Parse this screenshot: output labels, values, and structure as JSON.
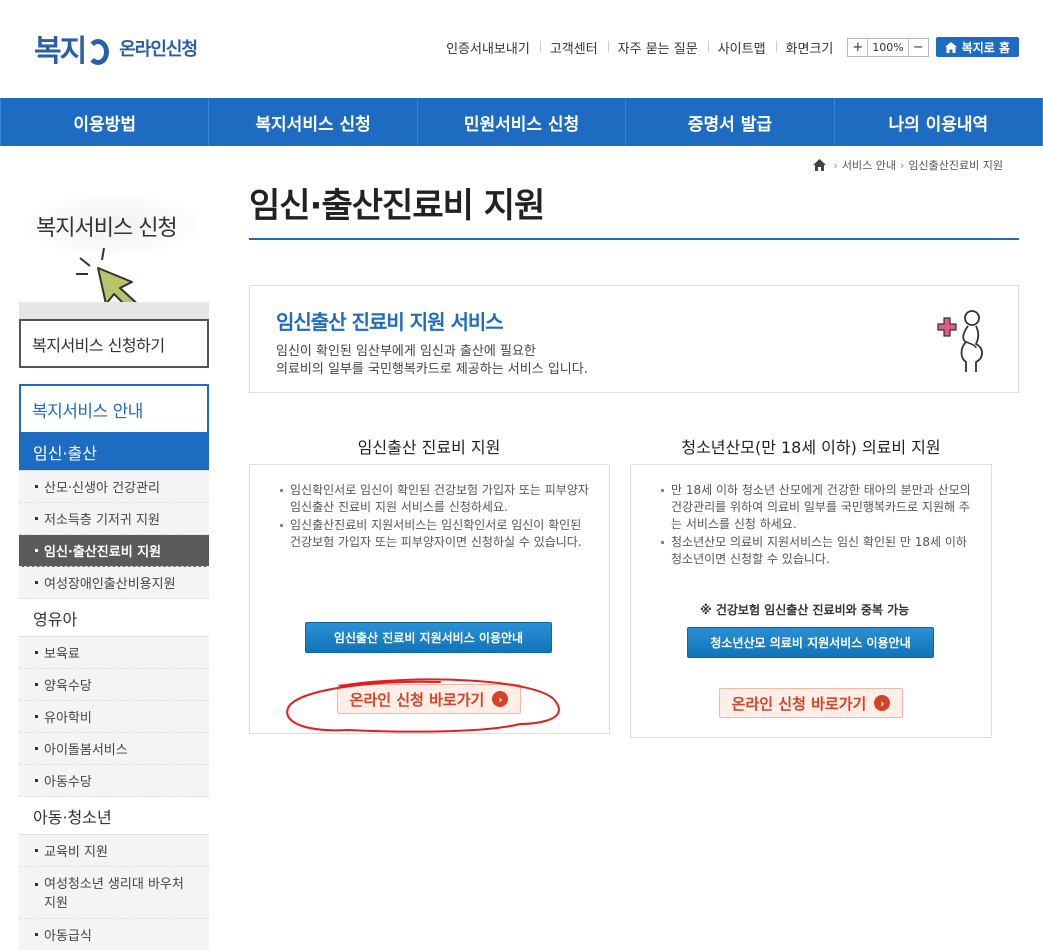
{
  "header": {
    "logo_text": "복지",
    "logo_sub": "온라인신청",
    "util_links": [
      "인증서내보내기",
      "고객센터",
      "자주 묻는 질문",
      "사이트맵"
    ],
    "zoom_label": "화면크기",
    "zoom_plus": "+",
    "zoom_value": "100%",
    "zoom_minus": "−",
    "home_button": "복지로 홈"
  },
  "gnb": [
    "이용방법",
    "복지서비스 신청",
    "민원서비스 신청",
    "증명서 발급",
    "나의 이용내역"
  ],
  "sidebar": {
    "title": "복지서비스 신청",
    "apply_link": "복지서비스 신청하기",
    "guide_title": "복지서비스 안내",
    "categories": [
      {
        "label": "임신·출산",
        "items": [
          "산모·신생아 건강관리",
          "저소득층 기저귀 지원",
          "임신·출산진료비 지원",
          "여성장애인출산비용지원"
        ]
      },
      {
        "label": "영유아",
        "items": [
          "보육료",
          "양육수당",
          "유아학비",
          "아이돌봄서비스",
          "아동수당"
        ]
      },
      {
        "label": "아동·청소년",
        "items": [
          "교육비 지원",
          "여성청소년 생리대 바우처 지원",
          "아동급식"
        ]
      }
    ]
  },
  "breadcrumb": {
    "items": [
      "서비스 안내",
      "임신출산진료비 지원"
    ]
  },
  "page": {
    "title": "임신·출산진료비 지원"
  },
  "intro": {
    "heading": "임신출산 진료비 지원 서비스",
    "line1": "임신이 확인된 임산부에게 임신과 출산에 필요한",
    "line2": "의료비의 일부를 국민행복카드로 제공하는 서비스 입니다."
  },
  "left_col": {
    "title": "임신출산 진료비 지원",
    "bullets": [
      "임신확인서로 임신이 확인된 건강보험 가입자 또는 피부양자 임신출산 진료비 지원 서비스를 신청하세요.",
      "임신출산진료비 지원서비스는 임신확인서로 임신이 확인된 건강보험 가입자 또는 피부양자이면 신청하실 수 있습니다."
    ],
    "guide_button": "임신출산 진료비 지원서비스 이용안내",
    "online_button": "온라인 신청 바로가기"
  },
  "right_col": {
    "title": "청소년산모(만 18세 이하) 의료비 지원",
    "bullets": [
      "만 18세 이하 청소년 산모에게 건강한 태아의 분만과 산모의 건강관리를 위하여 의료비 일부를 국민행복카드로 지원해 주는 서비스를 신청 하세요.",
      "청소년산모 의료비 지원서비스는 임신 확인된 만 18세 이하 청소년이면 신청할 수 있습니다."
    ],
    "note": "※ 건강보험 임신출산 진료비와 중복 가능",
    "guide_button": "청소년산모 의료비 지원서비스 이용안내",
    "online_button": "온라인 신청 바로가기"
  },
  "colors": {
    "brand_blue": "#1e6cc2",
    "annotation_red": "#e02020",
    "online_red": "#d2432a"
  }
}
